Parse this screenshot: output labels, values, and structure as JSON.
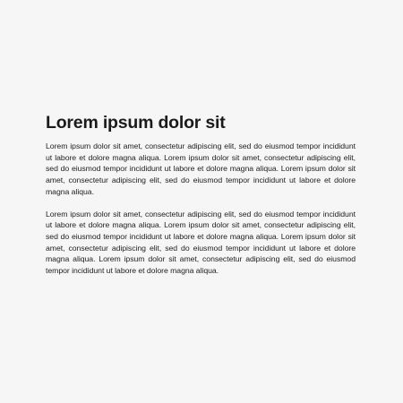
{
  "document": {
    "title": "Lorem ipsum dolor sit",
    "paragraphs": [
      "Lorem ipsum dolor sit amet, consectetur adipiscing elit, sed do eiusmod tempor incididunt ut labore et dolore magna aliqua. Lorem ipsum dolor sit amet, consectetur adipiscing elit, sed do eiusmod tempor incididunt ut labore et dolore magna aliqua. Lorem ipsum dolor sit amet, consectetur adipiscing elit, sed do eiusmod tempor incididunt ut labore et dolore magna aliqua.",
      "Lorem ipsum dolor sit amet, consectetur adipiscing elit, sed do eiusmod tempor incididunt ut labore et dolore magna aliqua. Lorem ipsum dolor sit amet, consectetur adipiscing elit, sed do eiusmod tempor incididunt ut labore et dolore magna aliqua. Lorem ipsum dolor sit amet, consectetur adipiscing elit, sed do eiusmod tempor incididunt ut labore et dolore magna aliqua. Lorem ipsum dolor sit amet, consectetur adipiscing elit, sed do eiusmod tempor incididunt ut labore et dolore magna aliqua."
    ]
  }
}
